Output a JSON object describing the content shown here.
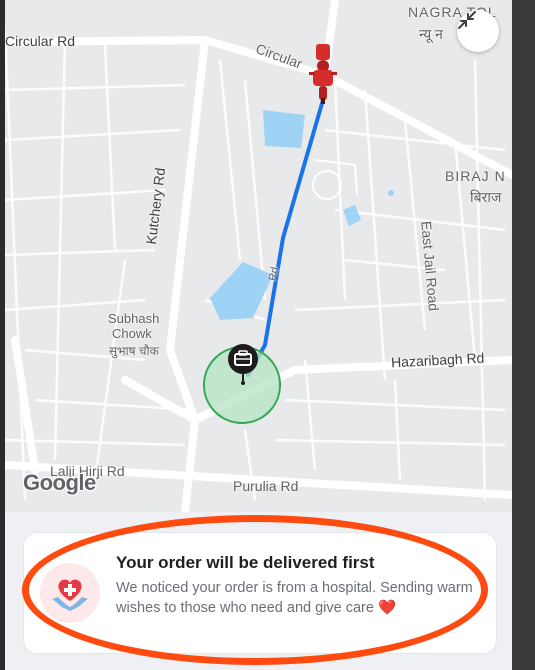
{
  "map": {
    "labels": {
      "circular_left": "Circular Rd",
      "circular_right": "Circular",
      "nagra_top": "NAGRA TOL",
      "nagra_hindi": "न्यू न",
      "kutchery": "Kutchery Rd",
      "biraj": "BIRAJ N",
      "biraj_hindi": "बिराज",
      "east_jail": "East Jail Road",
      "rd_small": "Rd",
      "subhash_1": "Subhash",
      "subhash_2": "Chowk",
      "subhash_hindi": "सुभाष चौक",
      "hazaribagh": "Hazaribagh Rd",
      "lalji": "Lalji Hirji Rd",
      "purulia": "Purulia Rd"
    },
    "google_logo": "Google",
    "collapse_icon": "collapse-arrows-icon",
    "route_color": "#1a73e8",
    "rider_color": "#d62c2c",
    "destination_circle_color": "#34a853"
  },
  "card": {
    "title": "Your order will be delivered first",
    "body": "We noticed your order is from a hospital. Sending warm wishes to those who need and give care ❤️",
    "icon": "heart-hands-icon"
  },
  "annotation_color": "#ff4a10"
}
